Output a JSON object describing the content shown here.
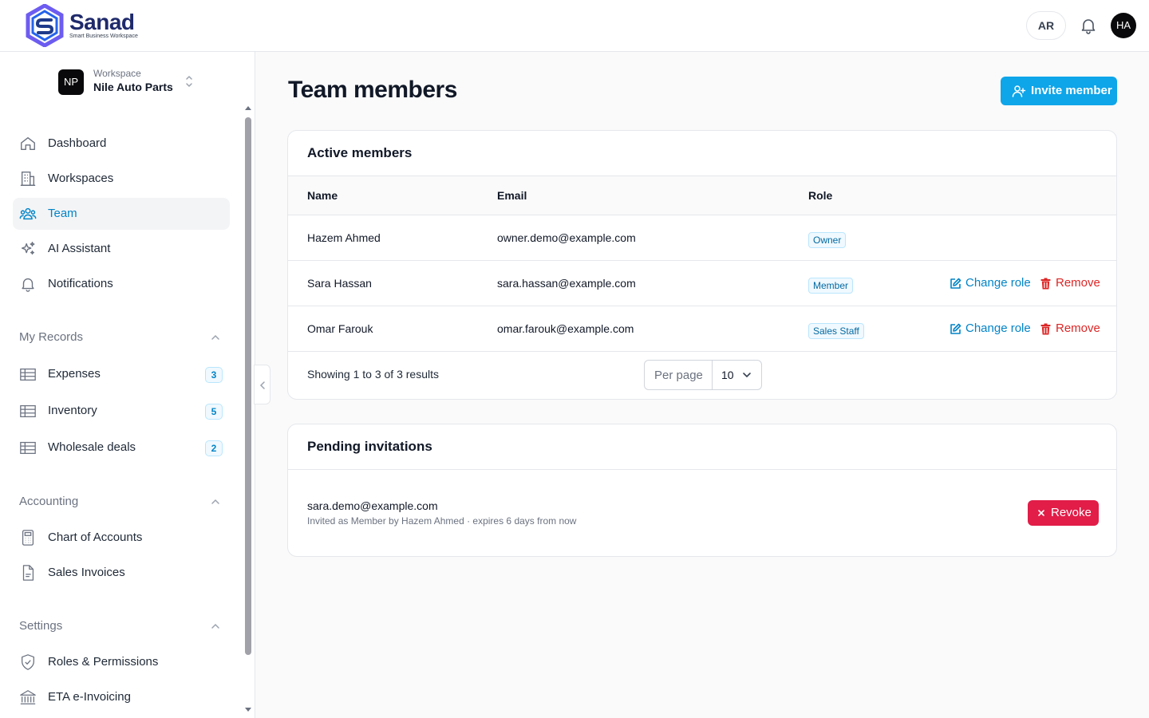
{
  "brand": {
    "name": "Sanad",
    "tagline": "Smart Business Workspace"
  },
  "header": {
    "lang_toggle": "AR",
    "user_initials": "HA"
  },
  "workspace": {
    "label": "Workspace",
    "name": "Nile Auto Parts",
    "initials": "NP"
  },
  "sidebar": {
    "items": [
      {
        "label": "Dashboard",
        "icon": "home-icon"
      },
      {
        "label": "Workspaces",
        "icon": "building-icon"
      },
      {
        "label": "Team",
        "icon": "users-icon",
        "active": true
      },
      {
        "label": "AI Assistant",
        "icon": "sparkles-icon"
      },
      {
        "label": "Notifications",
        "icon": "bell-icon"
      }
    ],
    "groups": [
      {
        "label": "My Records",
        "items": [
          {
            "label": "Expenses",
            "count": "3",
            "icon": "table-icon"
          },
          {
            "label": "Inventory",
            "count": "5",
            "icon": "table-icon"
          },
          {
            "label": "Wholesale deals",
            "count": "2",
            "icon": "table-icon"
          }
        ]
      },
      {
        "label": "Accounting",
        "items": [
          {
            "label": "Chart of Accounts",
            "icon": "calculator-icon"
          },
          {
            "label": "Sales Invoices",
            "icon": "document-icon"
          }
        ]
      },
      {
        "label": "Settings",
        "items": [
          {
            "label": "Roles & Permissions",
            "icon": "shield-check-icon"
          },
          {
            "label": "ETA e-Invoicing",
            "icon": "bank-icon"
          }
        ]
      }
    ]
  },
  "page": {
    "title": "Team members",
    "invite_label": "Invite member"
  },
  "active_members": {
    "title": "Active members",
    "columns": [
      "Name",
      "Email",
      "Role"
    ],
    "rows": [
      {
        "name": "Hazem Ahmed",
        "email": "owner.demo@example.com",
        "role": "Owner"
      },
      {
        "name": "Sara Hassan",
        "email": "sara.hassan@example.com",
        "role": "Member",
        "change_label": "Change role",
        "remove_label": "Remove"
      },
      {
        "name": "Omar Farouk",
        "email": "omar.farouk@example.com",
        "role": "Sales Staff",
        "change_label": "Change role",
        "remove_label": "Remove"
      }
    ],
    "showing": "Showing 1 to 3 of 3 results",
    "per_page_label": "Per page",
    "per_page_value": "10"
  },
  "pending": {
    "title": "Pending invitations",
    "invites": [
      {
        "email": "sara.demo@example.com",
        "meta": "Invited as Member by Hazem Ahmed · expires 6 days from now",
        "revoke_label": "Revoke"
      }
    ]
  },
  "colors": {
    "accent": "#0ea5e9",
    "active_nav": "#0284c7",
    "danger": "#dc2626",
    "revoke": "#e11d48",
    "brand": "#1f2a6b"
  }
}
